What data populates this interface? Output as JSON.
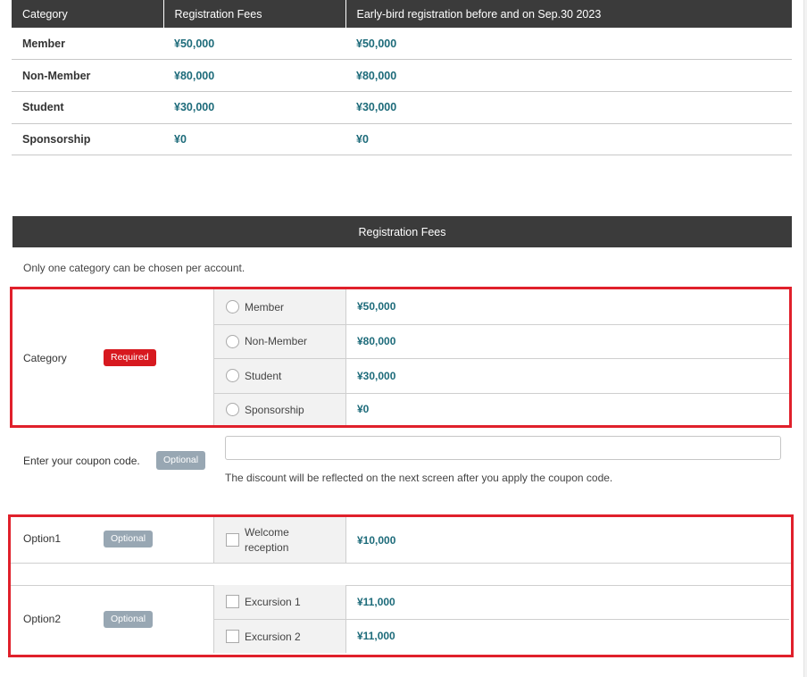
{
  "fee_table": {
    "headers": [
      "Category",
      "Registration Fees",
      "Early-bird registration before and on Sep.30 2023"
    ],
    "rows": [
      {
        "category": "Member",
        "fee": "¥50,000",
        "early": "¥50,000"
      },
      {
        "category": "Non-Member",
        "fee": "¥80,000",
        "early": "¥80,000"
      },
      {
        "category": "Student",
        "fee": "¥30,000",
        "early": "¥30,000"
      },
      {
        "category": "Sponsorship",
        "fee": "¥0",
        "early": "¥0"
      }
    ]
  },
  "registration": {
    "section_title": "Registration Fees",
    "note": "Only one category can be chosen per account.",
    "category_label": "Category",
    "required_badge": "Required",
    "options": [
      {
        "label": "Member",
        "price": "¥50,000"
      },
      {
        "label": "Non-Member",
        "price": "¥80,000"
      },
      {
        "label": "Student",
        "price": "¥30,000"
      },
      {
        "label": "Sponsorship",
        "price": "¥0"
      }
    ]
  },
  "coupon": {
    "label": "Enter your coupon code.",
    "badge": "Optional",
    "value": "",
    "note": "The discount will be reflected on the next screen after you apply the coupon code."
  },
  "extras": {
    "option1": {
      "label": "Option1",
      "badge": "Optional",
      "items": [
        {
          "label": "Welcome reception",
          "price": "¥10,000"
        }
      ]
    },
    "option2": {
      "label": "Option2",
      "badge": "Optional",
      "items": [
        {
          "label": "Excursion 1",
          "price": "¥11,000"
        },
        {
          "label": "Excursion 2",
          "price": "¥11,000"
        }
      ]
    }
  },
  "colors": {
    "header_bg": "#3b3b3b",
    "price": "#1d6b7a",
    "required": "#d7191f",
    "optional": "#98a7b3",
    "highlight": "#e0202b"
  }
}
